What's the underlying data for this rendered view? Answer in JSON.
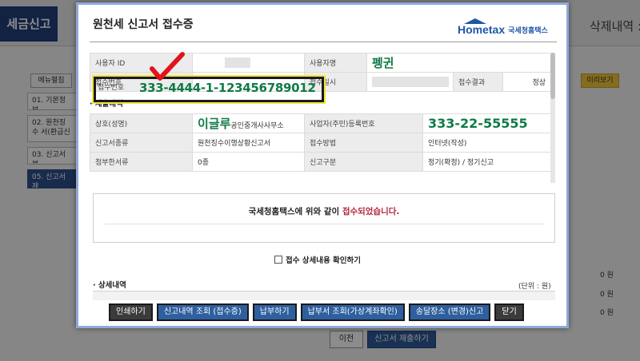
{
  "background": {
    "page_title": "세금신고",
    "right_title": "삭제내역 :",
    "menu_button": "메뉴펼침",
    "steps": [
      "01. 기본정보",
      "02. 원천징수 서(환급신",
      "03. 신고서부",
      "05. 신고서제"
    ],
    "preview_button": "미리보기",
    "amounts": [
      "0 원",
      "0 원",
      "0 원"
    ],
    "prev_button": "이전",
    "submit_button": "신고서 제출하기"
  },
  "modal": {
    "title": "원천세 신고서 접수증",
    "logo": {
      "brand": "Hometax",
      "korean": "국세청홈택스"
    },
    "receipt": {
      "user_id_label": "사용자 ID",
      "user_name_label": "사용자명",
      "user_name_value": "펭귄",
      "receipt_no_label": "접수번호",
      "receipt_no_value": "333-4444-1-123456789012",
      "receipt_date_label": "접수일시",
      "receipt_result_label": "접수결과",
      "receipt_result_value": "정상"
    },
    "submission_section_label": "· 제출내역",
    "submission": {
      "company_label": "상호(성명)",
      "company_value_hw": "이글루",
      "company_value": "공인중개사사무소",
      "bizno_label": "사업자(주민)등록번호",
      "bizno_value": "333-22-55555",
      "form_type_label": "신고서종류",
      "form_type_value": "원천징수이행상황신고서",
      "method_label": "접수방법",
      "method_value": "인터넷(작성)",
      "attach_label": "첨부한서류",
      "attach_value": "0종",
      "category_label": "신고구분",
      "category_value": "정기(확정) / 정기신고"
    },
    "notice": {
      "prefix": "국세청홈택스에 위와 같이 ",
      "highlight": "접수되었습니다."
    },
    "confirm_checkbox_label": "접수 상세내용 확인하기",
    "detail_section_label": "· 상세내역",
    "unit_label": "(단위 : 원)",
    "buttons": {
      "print": "인쇄하기",
      "view_receipt": "신고내역 조회 (접수증)",
      "pay": "납부하기",
      "bill_view": "납부서 조회(가상계좌확인)",
      "change_place": "송달장소 (변경)신고",
      "close": "닫기"
    }
  },
  "colors": {
    "accent_blue": "#2e5f9e",
    "handwriting_green": "#0e7a45",
    "highlight_red": "#b2263e",
    "annotation_yellow": "#f2e53a",
    "check_red": "#e0141c"
  }
}
